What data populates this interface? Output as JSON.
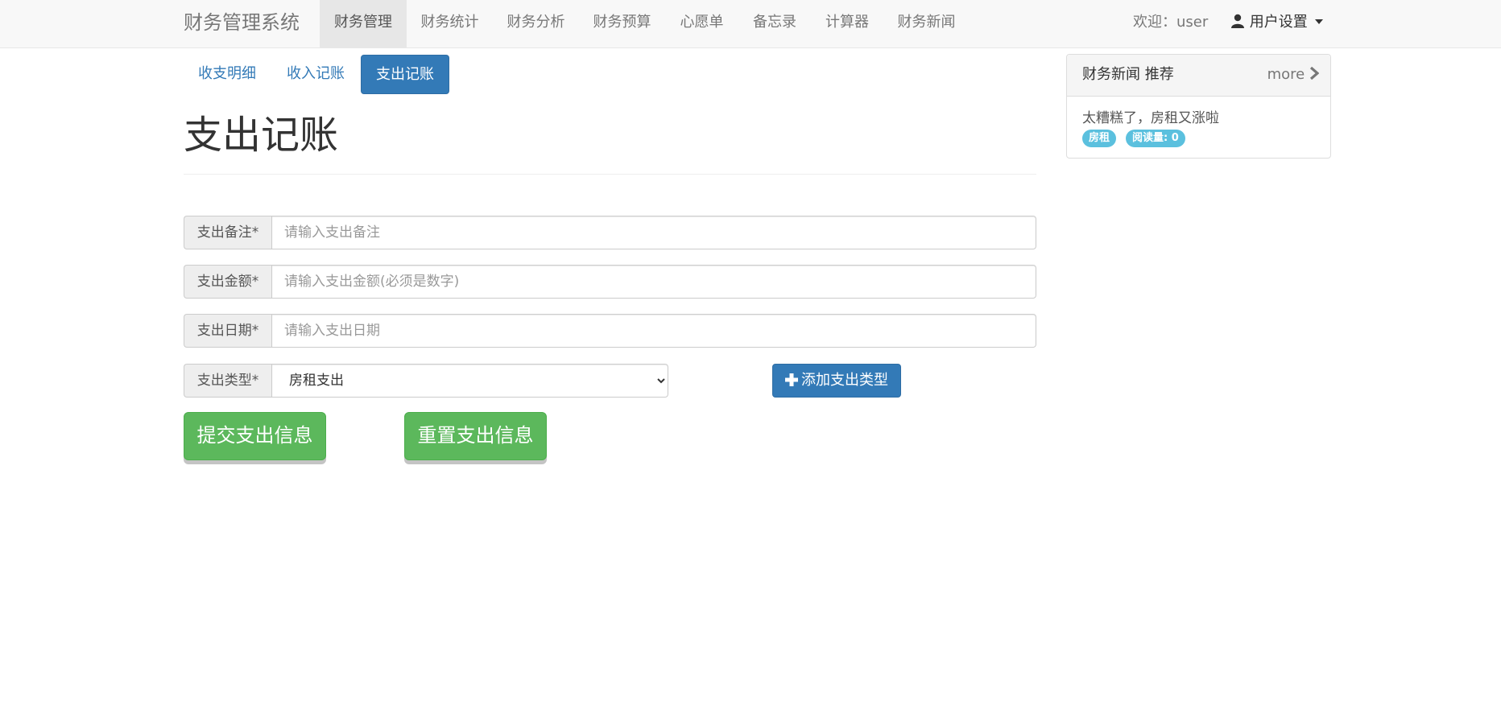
{
  "navbar": {
    "brand": "财务管理系统",
    "items": [
      {
        "label": "财务管理"
      },
      {
        "label": "财务统计"
      },
      {
        "label": "财务分析"
      },
      {
        "label": "财务预算"
      },
      {
        "label": "心愿单"
      },
      {
        "label": "备忘录"
      },
      {
        "label": "计算器"
      },
      {
        "label": "财务新闻"
      }
    ],
    "welcome": "欢迎：user",
    "user_settings": "用户设置"
  },
  "tabs": [
    {
      "label": "收支明细"
    },
    {
      "label": "收入记账"
    },
    {
      "label": "支出记账"
    }
  ],
  "page_title": "支出记账",
  "form": {
    "note_label": "支出备注*",
    "note_placeholder": "请输入支出备注",
    "amount_label": "支出金额*",
    "amount_placeholder": "请输入支出金额(必须是数字)",
    "date_label": "支出日期*",
    "date_placeholder": "请输入支出日期",
    "type_label": "支出类型*",
    "type_selected": "房租支出",
    "add_type_button": "添加支出类型",
    "submit_button": "提交支出信息",
    "reset_button": "重置支出信息"
  },
  "news_panel": {
    "title": "财务新闻 推荐",
    "more": "more",
    "item_title": "太糟糕了，房租又涨啦",
    "tag": "房租",
    "reads": "阅读量: 0"
  },
  "colors": {
    "primary": "#337ab7",
    "success": "#5cb85c",
    "info": "#5bc0de",
    "navbar_bg": "#f8f8f8"
  },
  "icons": [
    "person-icon",
    "caret-down-icon",
    "plus-icon",
    "chevron-right-icon"
  ]
}
